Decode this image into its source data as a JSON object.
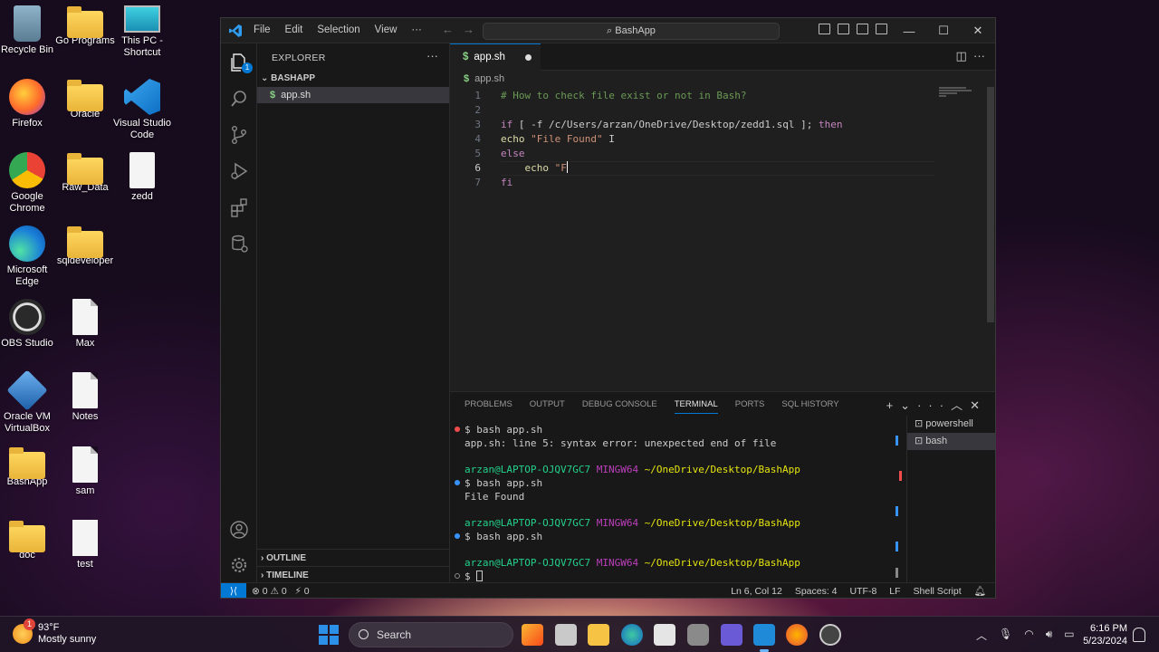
{
  "desktop": {
    "icons": [
      {
        "label": "Recycle Bin"
      },
      {
        "label": "Go Programs"
      },
      {
        "label": "This PC - Shortcut"
      },
      {
        "label": "Firefox"
      },
      {
        "label": "Oracle"
      },
      {
        "label": "Visual Studio Code"
      },
      {
        "label": "Google Chrome"
      },
      {
        "label": "Raw_Data"
      },
      {
        "label": "zedd"
      },
      {
        "label": "Microsoft Edge"
      },
      {
        "label": "sqldeveloper"
      },
      {
        "label": "OBS Studio"
      },
      {
        "label": "Max"
      },
      {
        "label": "Oracle VM VirtualBox"
      },
      {
        "label": "Notes"
      },
      {
        "label": "BashApp"
      },
      {
        "label": "sam"
      },
      {
        "label": "doc"
      },
      {
        "label": "test"
      }
    ]
  },
  "window": {
    "menu": [
      "File",
      "Edit",
      "Selection",
      "View",
      "···"
    ],
    "command_center": "BashApp",
    "explorer_title": "EXPLORER",
    "explorer_more": "···",
    "project": "BASHAPP",
    "file": "app.sh",
    "outline": "OUTLINE",
    "timeline": "TIMELINE",
    "tab_label": "app.sh",
    "breadcrumb": "app.sh",
    "accent": "#0078d4",
    "explorer_badge": "1"
  },
  "editor": {
    "lines": [
      {
        "n": "1",
        "parts": [
          {
            "t": "# How to check file exist or not in Bash?",
            "c": "comment"
          }
        ]
      },
      {
        "n": "2",
        "parts": []
      },
      {
        "n": "3",
        "parts": [
          {
            "t": "if",
            "c": "kw"
          },
          {
            "t": " [ ",
            "c": "path"
          },
          {
            "t": "-f /c/Users/arzan/OneDrive/Desktop/zedd1.sql",
            "c": "path"
          },
          {
            "t": " ]; ",
            "c": "path"
          },
          {
            "t": "then",
            "c": "kw"
          }
        ]
      },
      {
        "n": "4",
        "parts": [
          {
            "t": "echo",
            "c": "cmd"
          },
          {
            "t": " ",
            "c": "path"
          },
          {
            "t": "\"File Found\"",
            "c": "str"
          },
          {
            "t": " I",
            "c": "path"
          }
        ]
      },
      {
        "n": "5",
        "parts": [
          {
            "t": "else",
            "c": "kw"
          }
        ]
      },
      {
        "n": "6",
        "parts": [
          {
            "t": "    ",
            "c": "path"
          },
          {
            "t": "echo",
            "c": "cmd"
          },
          {
            "t": " ",
            "c": "path"
          },
          {
            "t": "\"F",
            "c": "str"
          }
        ]
      },
      {
        "n": "7",
        "parts": [
          {
            "t": "fi",
            "c": "kw"
          }
        ]
      }
    ]
  },
  "panel": {
    "tabs": [
      "PROBLEMS",
      "OUTPUT",
      "DEBUG CONSOLE",
      "TERMINAL",
      "PORTS",
      "SQL HISTORY"
    ],
    "active_tab": "TERMINAL",
    "terminal": [
      {
        "type": "cmd",
        "dot": "#f14c4c",
        "text": "$ bash app.sh"
      },
      {
        "type": "out",
        "text": "app.sh: line 5: syntax error: unexpected end of file"
      },
      {
        "type": "blank"
      },
      {
        "type": "prompt",
        "user": "arzan@LAPTOP-OJQV7GC7",
        "env": "MINGW64",
        "path": "~/OneDrive/Desktop/BashApp"
      },
      {
        "type": "cmd",
        "dot": "#3794ff",
        "text": "$ bash app.sh"
      },
      {
        "type": "out",
        "text": "File Found"
      },
      {
        "type": "blank"
      },
      {
        "type": "prompt",
        "user": "arzan@LAPTOP-OJQV7GC7",
        "env": "MINGW64",
        "path": "~/OneDrive/Desktop/BashApp"
      },
      {
        "type": "cmd",
        "dot": "#3794ff",
        "text": "$ bash app.sh"
      },
      {
        "type": "blank"
      },
      {
        "type": "prompt",
        "user": "arzan@LAPTOP-OJQV7GC7",
        "env": "MINGW64",
        "path": "~/OneDrive/Desktop/BashApp"
      },
      {
        "type": "cmd",
        "dot": "#888888",
        "text": "$ "
      }
    ],
    "terminals": [
      "powershell",
      "bash"
    ],
    "active_terminal": "bash"
  },
  "statusbar": {
    "errors": "0",
    "warnings": "0",
    "ports": "0",
    "position": "Ln 6, Col 12",
    "spaces": "Spaces: 4",
    "encoding": "UTF-8",
    "eol": "LF",
    "language": "Shell Script"
  },
  "taskbar": {
    "temperature": "93°F",
    "condition": "Mostly sunny",
    "weather_badge": "1",
    "search": "Search",
    "time": "6:16 PM",
    "date": "5/23/2024"
  }
}
